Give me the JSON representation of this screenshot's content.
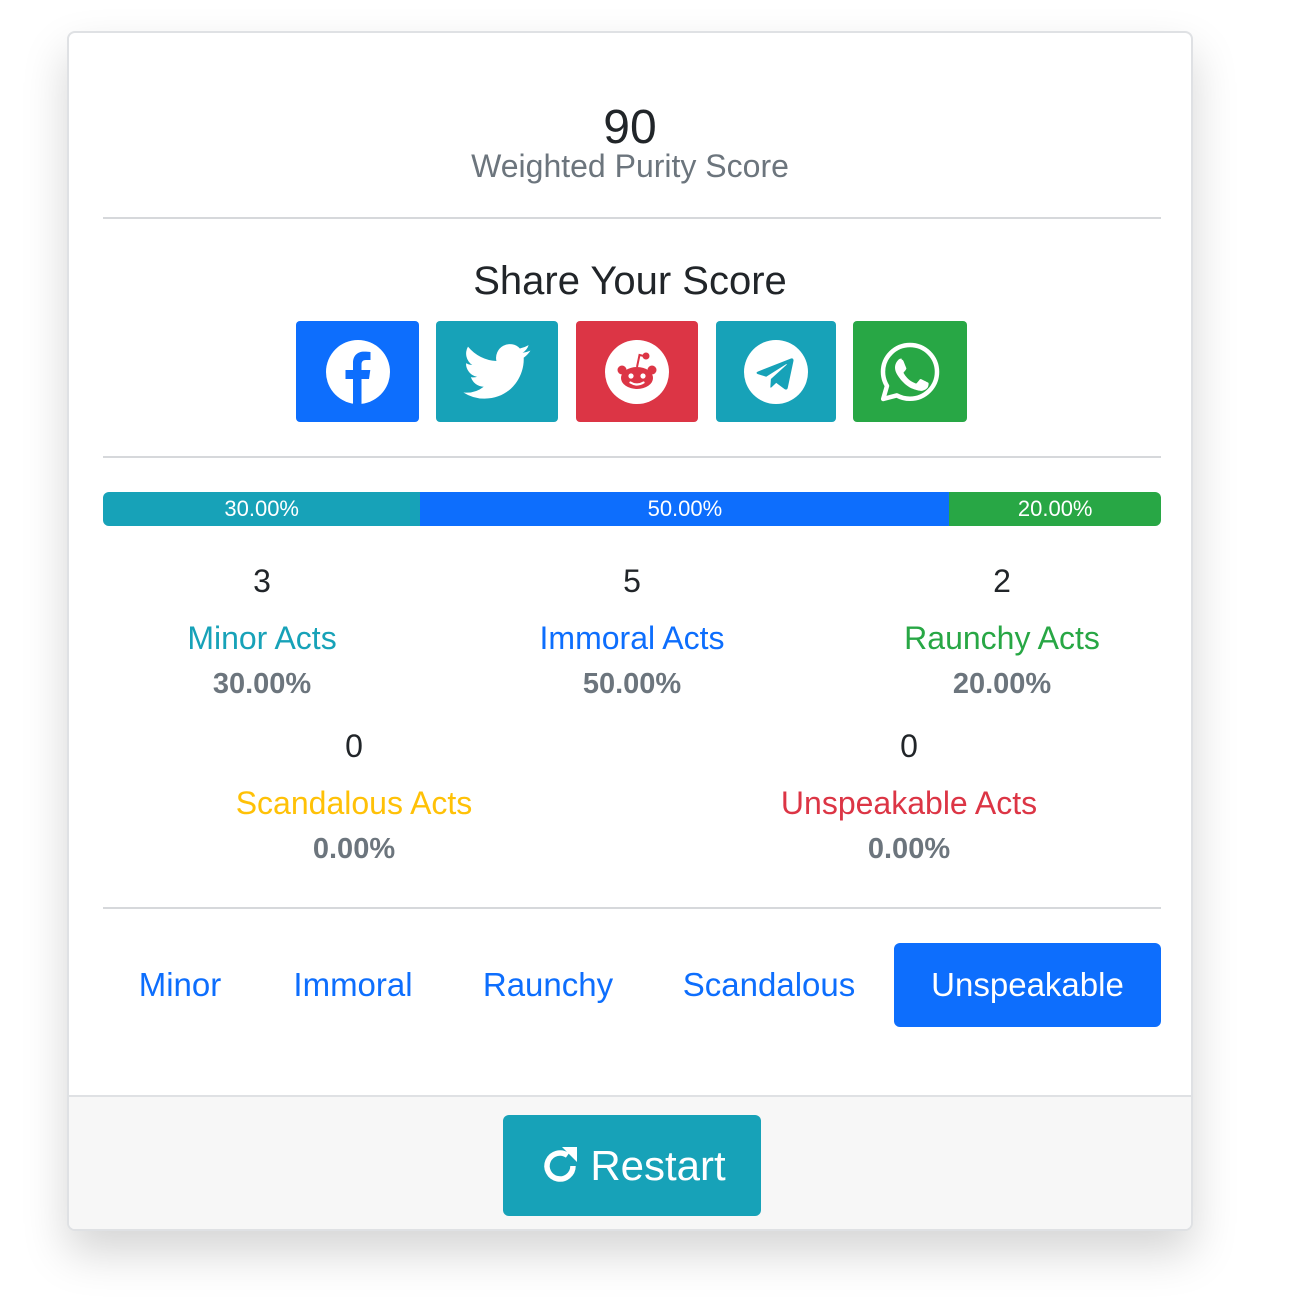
{
  "score": {
    "value": "90",
    "label": "Weighted Purity Score"
  },
  "share": {
    "title": "Share Your Score",
    "buttons": [
      {
        "name": "facebook",
        "icon": "facebook-icon",
        "color": "#0d6efd"
      },
      {
        "name": "twitter",
        "icon": "twitter-icon",
        "color": "#17a2b8"
      },
      {
        "name": "reddit",
        "icon": "reddit-icon",
        "color": "#dc3545"
      },
      {
        "name": "telegram",
        "icon": "telegram-icon",
        "color": "#17a2b8"
      },
      {
        "name": "whatsapp",
        "icon": "whatsapp-icon",
        "color": "#28a745"
      }
    ]
  },
  "progress": [
    {
      "label": "30.00%",
      "fraction": 0.3,
      "color": "#17a2b8"
    },
    {
      "label": "50.00%",
      "fraction": 0.5,
      "color": "#0d6efd"
    },
    {
      "label": "20.00%",
      "fraction": 0.2,
      "color": "#28a745"
    }
  ],
  "stats": [
    {
      "count": "3",
      "name": "Minor Acts",
      "percent": "30.00%",
      "color": "#17a2b8"
    },
    {
      "count": "5",
      "name": "Immoral Acts",
      "percent": "50.00%",
      "color": "#0d6efd"
    },
    {
      "count": "2",
      "name": "Raunchy Acts",
      "percent": "20.00%",
      "color": "#28a745"
    },
    {
      "count": "0",
      "name": "Scandalous Acts",
      "percent": "0.00%",
      "color": "#ffc107"
    },
    {
      "count": "0",
      "name": "Unspeakable Acts",
      "percent": "0.00%",
      "color": "#dc3545"
    }
  ],
  "tabs": [
    {
      "label": "Minor",
      "active": false
    },
    {
      "label": "Immoral",
      "active": false
    },
    {
      "label": "Raunchy",
      "active": false
    },
    {
      "label": "Scandalous",
      "active": false
    },
    {
      "label": "Unspeakable",
      "active": true
    }
  ],
  "footer": {
    "restart_label": "Restart",
    "restart_icon": "restart-icon",
    "restart_color": "#17a2b8"
  }
}
